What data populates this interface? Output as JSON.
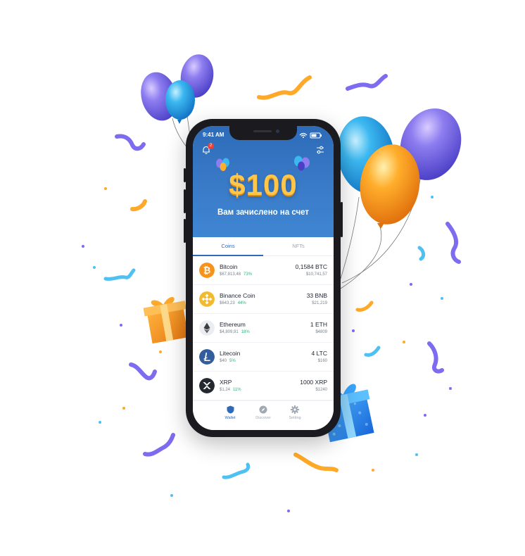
{
  "status_bar": {
    "time": "9:41 AM"
  },
  "notifications": {
    "count": "2"
  },
  "banner": {
    "amount": "$100",
    "subtitle": "Вам зачислено на счет"
  },
  "tabs": [
    {
      "label": "Coins",
      "active": true
    },
    {
      "label": "NFTs",
      "active": false
    }
  ],
  "coins": [
    {
      "name": "Bitcoin",
      "price": "$67,813,48",
      "change": "73%",
      "amount": "0,1584 BTC",
      "value": "$10,741,57",
      "icon": "bitcoin-icon",
      "color": "#f7931a"
    },
    {
      "name": "Binance Coin",
      "price": "$643,23",
      "change": "44%",
      "amount": "33 BNB",
      "value": "$21,219",
      "icon": "binance-icon",
      "color": "#f3ba2f"
    },
    {
      "name": "Ethereum",
      "price": "$4,809,91",
      "change": "18%",
      "amount": "1 ETH",
      "value": "$4809",
      "icon": "ethereum-icon",
      "color": "#ecedf2"
    },
    {
      "name": "Litecoin",
      "price": "$40",
      "change": "5%",
      "amount": "4 LTC",
      "value": "$160",
      "icon": "litecoin-icon",
      "color": "#345d9d"
    },
    {
      "name": "XRP",
      "price": "$1,24",
      "change": "11%",
      "amount": "1000 XRP",
      "value": "$1240",
      "icon": "xrp-icon",
      "color": "#23292f"
    }
  ],
  "nav": [
    {
      "label": "Wallet",
      "icon": "shield-icon",
      "active": true
    },
    {
      "label": "Discover",
      "icon": "compass-icon",
      "active": false
    },
    {
      "label": "Setting",
      "icon": "gear-icon",
      "active": false
    }
  ],
  "colors": {
    "accent": "#2d6bb8",
    "gold": "#ffc64a",
    "positive": "#2fb27d",
    "badge": "#e8423b"
  }
}
